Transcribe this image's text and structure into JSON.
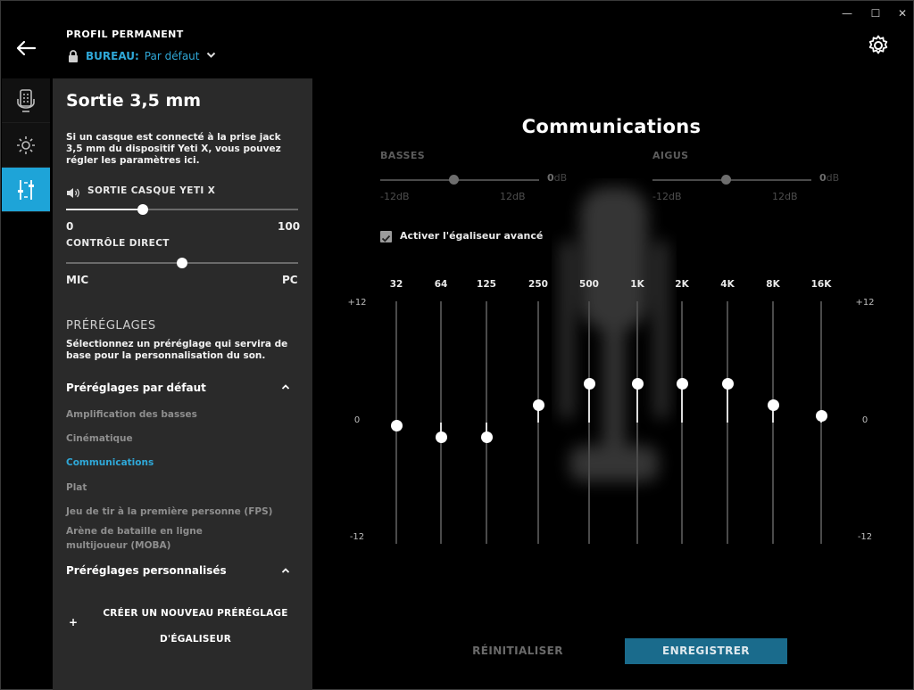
{
  "window": {
    "minimize_glyph": "—",
    "maximize_glyph": "☐",
    "close_glyph": "✕"
  },
  "header": {
    "profile_title": "PROFIL PERMANENT",
    "profile_name": "BUREAU:",
    "profile_value": "Par défaut",
    "back_icon": "arrow-left-icon",
    "settings_icon": "gear-icon"
  },
  "rail": [
    {
      "icon": "microphone-device-icon",
      "active": false
    },
    {
      "icon": "brightness-icon",
      "active": false
    },
    {
      "icon": "sliders-icon",
      "active": true
    }
  ],
  "panel": {
    "title": "Sortie 3,5 mm",
    "description": "Si un casque est connecté à la prise jack 3,5 mm du dispositif Yeti X, vous pouvez régler les paramètres ici.",
    "headphone_label": "SORTIE CASQUE YETI X",
    "headphone_value": 0.33,
    "headphone_min": "0",
    "headphone_max": "100",
    "monitor_label": "CONTRÔLE DIRECT",
    "monitor_value": 0.5,
    "monitor_min": "MIC",
    "monitor_max": "PC",
    "presets_heading": "PRÉRÉGLAGES",
    "presets_description": "Sélectionnez un préréglage qui servira de base pour la personnalisation du son.",
    "default_group": "Préréglages par défaut",
    "presets": [
      "Amplification des basses",
      "Cinématique",
      "Communications",
      "Plat",
      "Jeu de tir à la première personne (FPS)",
      "Arène de bataille en ligne multijoueur (MOBA)"
    ],
    "active_preset": "Communications",
    "custom_group": "Préréglages personnalisés",
    "create_button_line1": "CRÉER UN NOUVEAU PRÉRÉGLAGE",
    "create_button_line2": "D'ÉGALISEUR",
    "create_plus": "+"
  },
  "equalizer": {
    "title": "Communications",
    "bass": {
      "label": "BASSES",
      "value": "0",
      "unit": "dB",
      "min": "-12dB",
      "max": "12dB",
      "level": 0
    },
    "treble": {
      "label": "AIGUS",
      "value": "0",
      "unit": "dB",
      "min": "-12dB",
      "max": "12dB",
      "level": 0
    },
    "advanced_label": "Activer l'égaliseur avancé",
    "advanced_enabled": true,
    "axis_top": "+12",
    "axis_mid": "0",
    "axis_bottom": "-12",
    "bands": [
      {
        "freq": "32",
        "gain": -0.3
      },
      {
        "freq": "64",
        "gain": -1.4
      },
      {
        "freq": "125",
        "gain": -1.4
      },
      {
        "freq": "250",
        "gain": 1.8
      },
      {
        "freq": "500",
        "gain": 3.9
      },
      {
        "freq": "1K",
        "gain": 3.9
      },
      {
        "freq": "2K",
        "gain": 3.9
      },
      {
        "freq": "4K",
        "gain": 3.9
      },
      {
        "freq": "8K",
        "gain": 1.8
      },
      {
        "freq": "16K",
        "gain": 0.7
      }
    ],
    "reset_label": "RÉINITIALISER",
    "save_label": "ENREGISTRER"
  }
}
